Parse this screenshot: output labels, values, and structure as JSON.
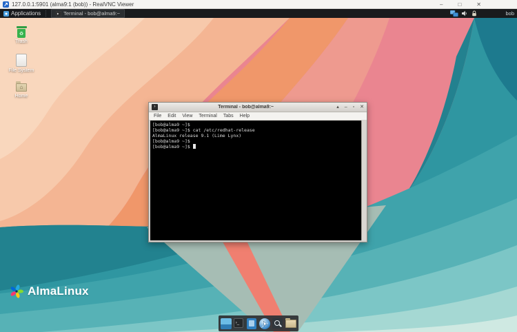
{
  "vnc": {
    "title": "127.0.0.1:5901 (alma9:1 (bob)) - RealVNC Viewer",
    "controls": {
      "minimize": "–",
      "maximize": "□",
      "close": "✕"
    }
  },
  "panel": {
    "applications_label": "Applications",
    "taskbar_item": "Terminal - bob@alma9:~",
    "username": "bob",
    "tray_icons": [
      "network",
      "volume",
      "lock"
    ]
  },
  "desktop": {
    "icons": [
      {
        "name": "trash",
        "label": "Trash"
      },
      {
        "name": "file-system",
        "label": "File System"
      },
      {
        "name": "home",
        "label": "Home"
      }
    ],
    "logo_text": "AlmaLinux"
  },
  "terminal": {
    "title": "Terminal - bob@alma9:~",
    "menu": [
      "File",
      "Edit",
      "View",
      "Terminal",
      "Tabs",
      "Help"
    ],
    "controls": {
      "shade": "▴",
      "minimize": "–",
      "maximize": "▫",
      "close": "✕"
    },
    "lines": [
      "[bob@alma9 ~]$",
      "[bob@alma9 ~]$ cat /etc/redhat-release",
      "AlmaLinux release 9.1 (Lime Lynx)",
      "[bob@alma9 ~]$",
      "[bob@alma9 ~]$"
    ]
  },
  "dock": {
    "items": [
      "show-desktop",
      "terminal",
      "text-editor",
      "web-browser",
      "application-finder",
      "file-manager"
    ]
  },
  "colors": {
    "teal": "#2a8f9d",
    "pink": "#e98794",
    "peach": "#f4b593",
    "orange": "#f0976a",
    "salmon_stripe": "#f07f70",
    "panel_bg": "#191b1d",
    "terminal_bg": "#000000",
    "accent_blue": "#4a9ede"
  }
}
